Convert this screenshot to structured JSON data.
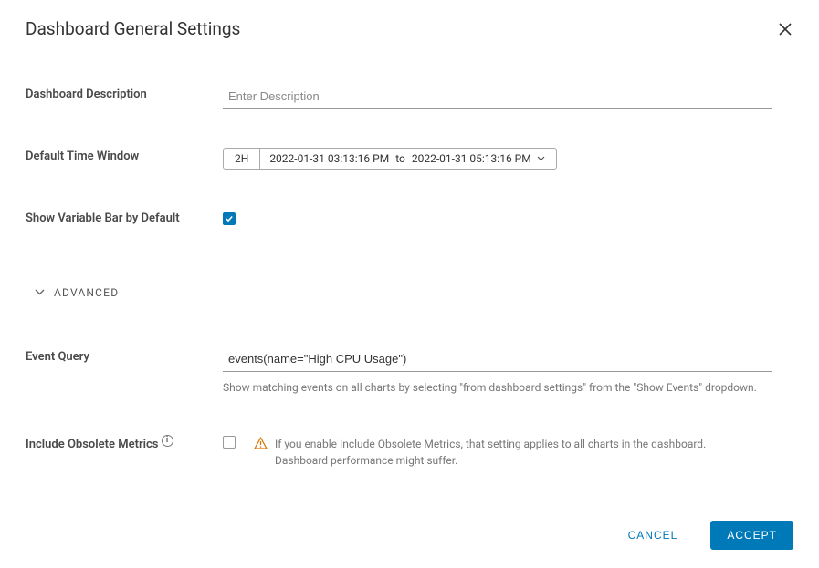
{
  "title": "Dashboard General Settings",
  "labels": {
    "description": "Dashboard Description",
    "time_window": "Default Time Window",
    "variable_bar": "Show Variable Bar by Default",
    "advanced": "Advanced",
    "event_query": "Event Query",
    "obsolete": "Include Obsolete Metrics"
  },
  "fields": {
    "description": {
      "placeholder": "Enter Description",
      "value": ""
    },
    "time_preset": "2H",
    "time_from": "2022-01-31 03:13:16 PM",
    "time_to_word": "to",
    "time_to": "2022-01-31 05:13:16 PM",
    "variable_bar_checked": true,
    "event_query_value": "events(name=\"High CPU Usage\")",
    "event_query_help": "Show matching events on all charts by selecting \"from dashboard settings\" from the \"Show Events\" dropdown.",
    "obsolete_checked": false,
    "obsolete_note": "If you enable Include Obsolete Metrics, that setting applies to all charts in the dashboard. Dashboard performance might suffer."
  },
  "buttons": {
    "cancel": "Cancel",
    "accept": "Accept"
  },
  "info_badge": "i"
}
